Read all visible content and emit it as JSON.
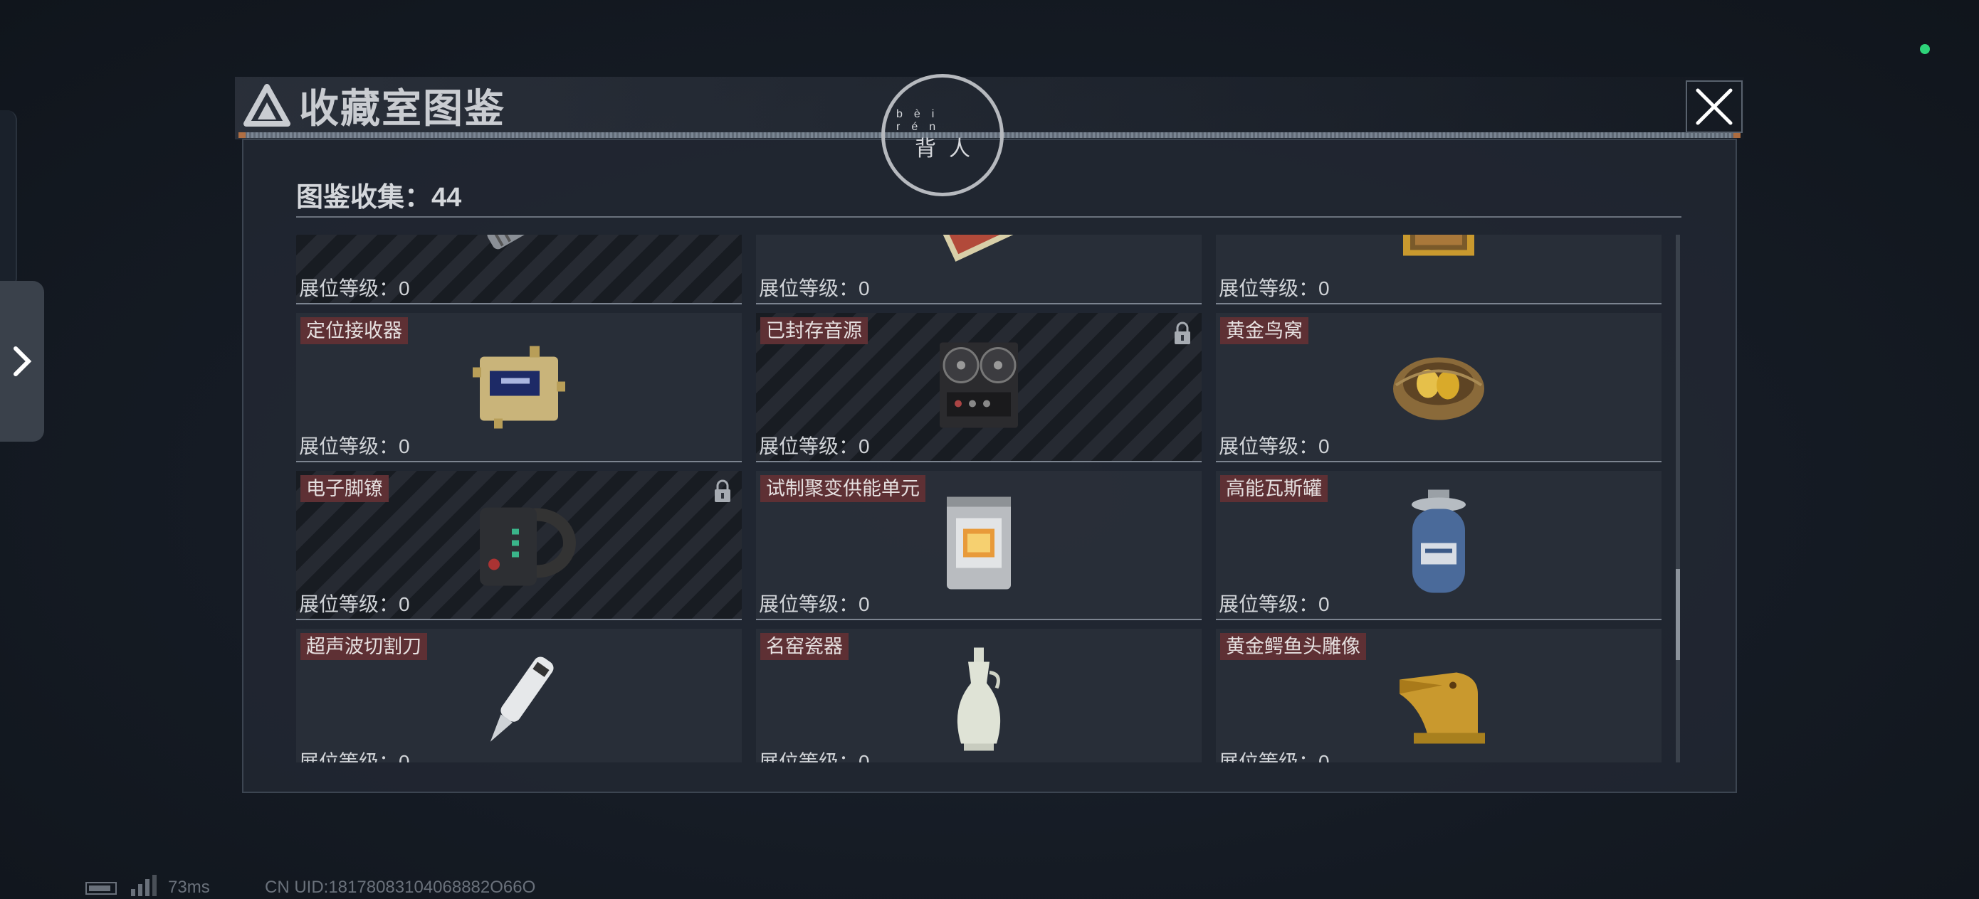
{
  "header": {
    "title": "收藏室图鉴",
    "close_icon": "close-icon"
  },
  "ring": {
    "pinyin": "bèi rén",
    "text": "背人"
  },
  "collection": {
    "label": "图鉴收集：44"
  },
  "cells": [
    {
      "name": "",
      "level": "展位等级：0",
      "locked": true,
      "icon": "flashlight-icon"
    },
    {
      "name": "",
      "level": "展位等级：0",
      "locked": false,
      "icon": "book-icon"
    },
    {
      "name": "",
      "level": "展位等级：0",
      "locked": false,
      "icon": "framed-painting-icon"
    },
    {
      "name": "定位接收器",
      "level": "展位等级：0",
      "locked": false,
      "icon": "receiver-icon"
    },
    {
      "name": "已封存音源",
      "level": "展位等级：0",
      "locked": true,
      "icon": "tape-recorder-icon"
    },
    {
      "name": "黄金鸟窝",
      "level": "展位等级：0",
      "locked": false,
      "icon": "golden-nest-icon"
    },
    {
      "name": "电子脚镣",
      "level": "展位等级：0",
      "locked": true,
      "icon": "ankle-monitor-icon"
    },
    {
      "name": "试制聚变供能单元",
      "level": "展位等级：0",
      "locked": false,
      "icon": "fusion-unit-icon"
    },
    {
      "name": "高能瓦斯罐",
      "level": "展位等级：0",
      "locked": false,
      "icon": "gas-tank-icon"
    },
    {
      "name": "超声波切割刀",
      "level": "展位等级：0",
      "locked": false,
      "icon": "ultrasonic-cutter-icon"
    },
    {
      "name": "名窑瓷器",
      "level": "展位等级：0",
      "locked": false,
      "icon": "porcelain-vase-icon"
    },
    {
      "name": "黄金鳄鱼头雕像",
      "level": "展位等级：0",
      "locked": false,
      "icon": "golden-croc-statue-icon"
    }
  ],
  "footer": {
    "ping": "73ms",
    "uid": "CN UID:18178083104068882O66O"
  },
  "colors": {
    "status_dot": "#2ed47a",
    "name_tag": "#5e3034",
    "panel": "#222832"
  }
}
